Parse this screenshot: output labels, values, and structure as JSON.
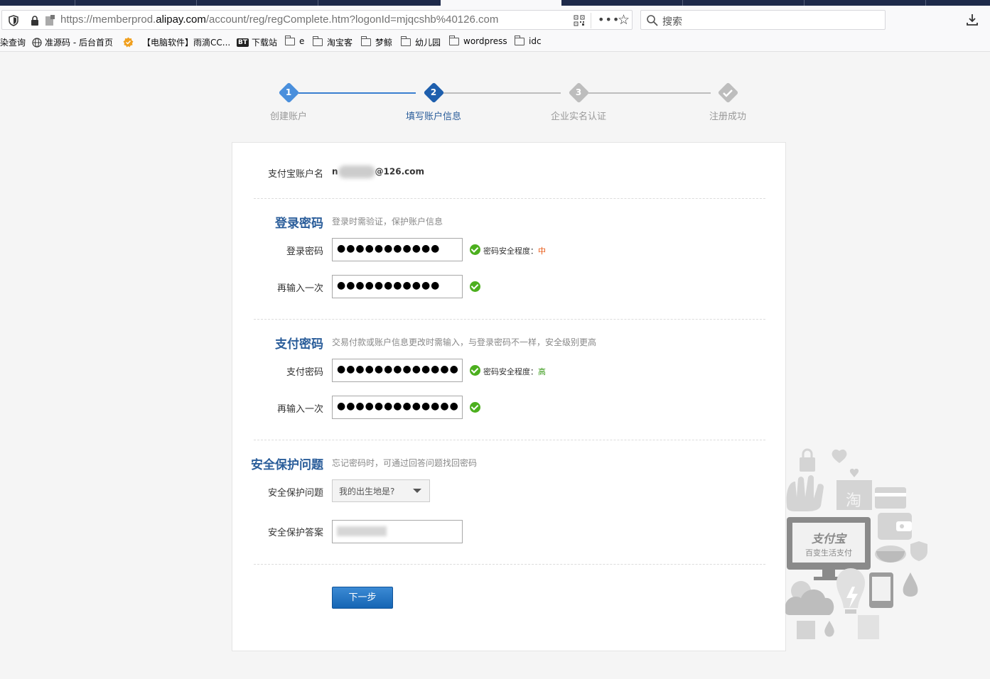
{
  "browser": {
    "url_prefix": "https://memberprod.",
    "url_domain": "alipay.com",
    "url_path": "/account/reg/regComplete.htm?logonId=mjqcshb%40126.com",
    "search_placeholder": "搜索"
  },
  "bookmarks": [
    {
      "label": "染查询",
      "icon": "none"
    },
    {
      "label": "准源码 - 后台首页",
      "icon": "globe-icon"
    },
    {
      "label": "【电脑软件】雨滴CC...",
      "icon": "badge-icon"
    },
    {
      "label": "下载站",
      "icon": "bt-icon",
      "icon_text": "BT"
    },
    {
      "label": "e",
      "icon": "folder-icon"
    },
    {
      "label": "淘宝客",
      "icon": "folder-icon"
    },
    {
      "label": "梦鲸",
      "icon": "folder-icon"
    },
    {
      "label": "幼儿园",
      "icon": "folder-icon"
    },
    {
      "label": "wordpress",
      "icon": "folder-icon"
    },
    {
      "label": "idc",
      "icon": "folder-icon"
    }
  ],
  "steps": [
    {
      "num": "1",
      "label": "创建账户",
      "state": "done"
    },
    {
      "num": "2",
      "label": "填写账户信息",
      "state": "current"
    },
    {
      "num": "3",
      "label": "企业实名认证",
      "state": "todo"
    },
    {
      "num": "",
      "label": "注册成功",
      "state": "todo"
    }
  ],
  "account": {
    "label": "支付宝账户名",
    "value_start": "n",
    "value_end": "@126.com"
  },
  "login_password": {
    "title": "登录密码",
    "hint": "登录时需验证，保护账户信息",
    "field_label": "登录密码",
    "field_value": "●●●●●●●●●●●",
    "confirm_label": "再输入一次",
    "confirm_value": "●●●●●●●●●●●",
    "strength_label": "密码安全程度：",
    "strength_value": "中",
    "strength_color": "#e8540e"
  },
  "pay_password": {
    "title": "支付密码",
    "hint": "交易付款或账户信息更改时需输入，与登录密码不一样，安全级别更高",
    "field_label": "支付密码",
    "field_value": "●●●●●●●●●●●●●",
    "confirm_label": "再输入一次",
    "confirm_value": "●●●●●●●●●●●●●",
    "strength_label": "密码安全程度：",
    "strength_value": "高",
    "strength_color": "#3a9a1a"
  },
  "security": {
    "title": "安全保护问题",
    "hint": "忘记密码时，可通过回答问题找回密码",
    "question_label": "安全保护问题",
    "question_value": "我的出生地是?",
    "answer_label": "安全保护答案"
  },
  "next_button": "下一步",
  "decoration": {
    "tao_char": "淘",
    "logo_text": "支付宝",
    "slogan": "百变生活支付"
  },
  "colors": {
    "accent": "#2a5d9a",
    "step_active": "#3a7fd0",
    "step_inactive": "#bdbdbd",
    "check_green": "#4caf1e"
  }
}
